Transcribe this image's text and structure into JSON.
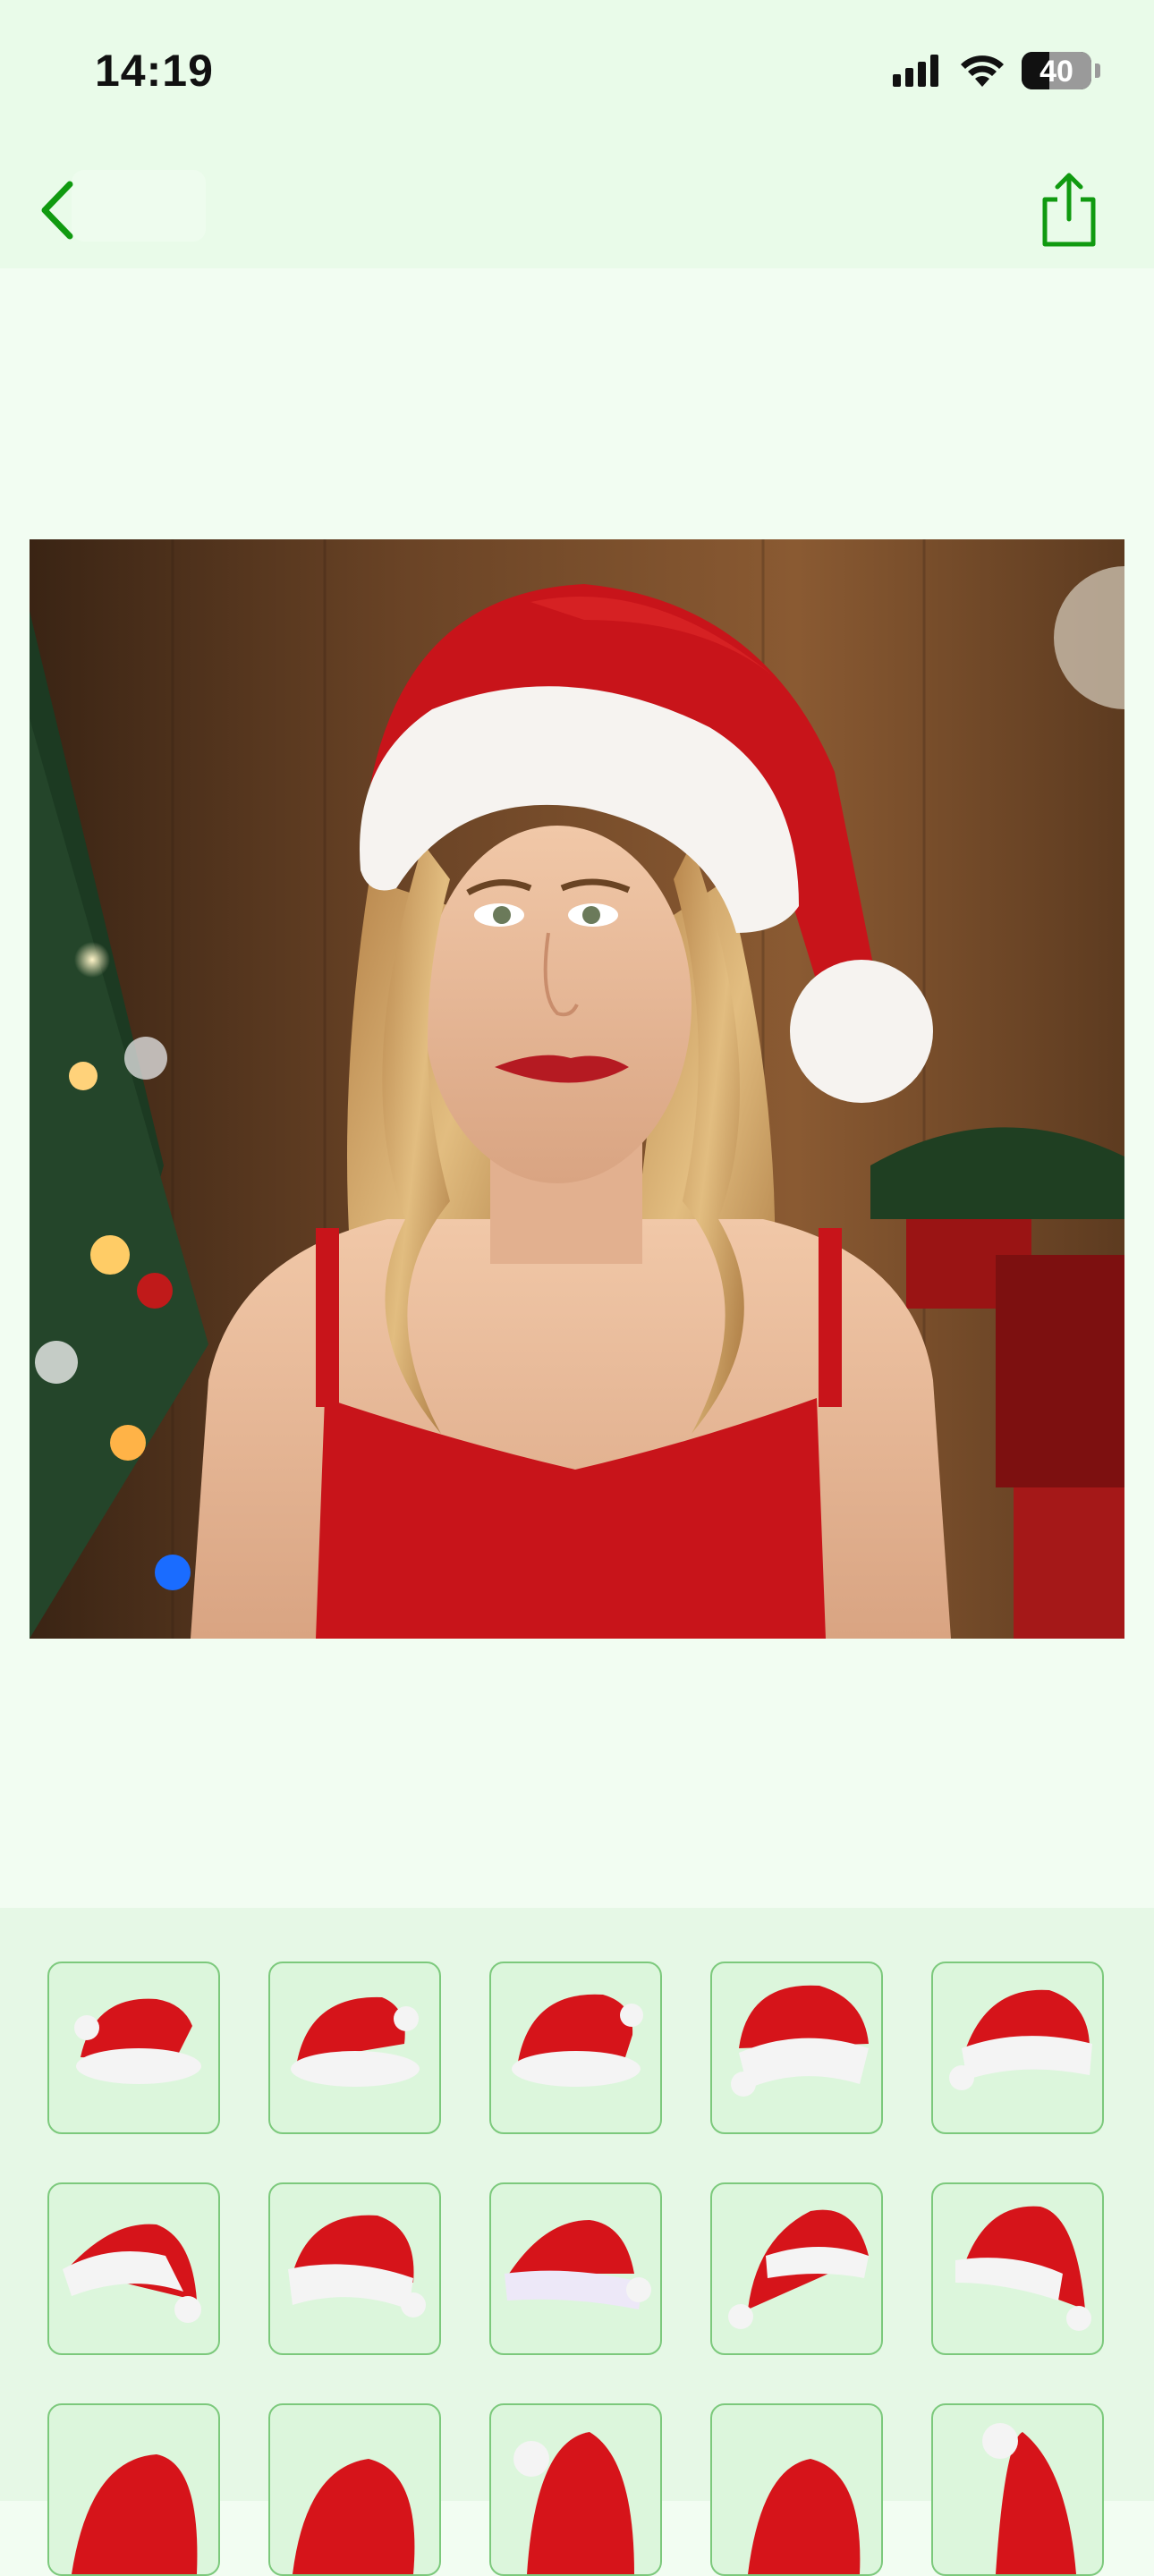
{
  "status_bar": {
    "time": "14:19",
    "battery_level": "40",
    "icons": [
      "signal-icon",
      "wifi-icon",
      "battery-icon"
    ]
  },
  "nav_bar": {
    "back_icon": "chevron-left-icon",
    "share_icon": "share-icon",
    "accent_color": "#109a10"
  },
  "canvas": {
    "image": "woman-in-santa-hat-photo"
  },
  "hat_picker": {
    "border_color": "#7cc97c",
    "cell_background": "#dcf6dc",
    "items": [
      {
        "name": "santa-hat-1"
      },
      {
        "name": "santa-hat-2"
      },
      {
        "name": "santa-hat-3"
      },
      {
        "name": "santa-hat-4"
      },
      {
        "name": "santa-hat-5"
      },
      {
        "name": "santa-hat-6"
      },
      {
        "name": "santa-hat-7"
      },
      {
        "name": "santa-hat-8"
      },
      {
        "name": "santa-hat-9"
      },
      {
        "name": "santa-hat-10"
      },
      {
        "name": "santa-hat-11"
      },
      {
        "name": "santa-hat-12"
      },
      {
        "name": "santa-hat-13"
      },
      {
        "name": "santa-hat-14"
      },
      {
        "name": "santa-hat-15"
      }
    ]
  }
}
